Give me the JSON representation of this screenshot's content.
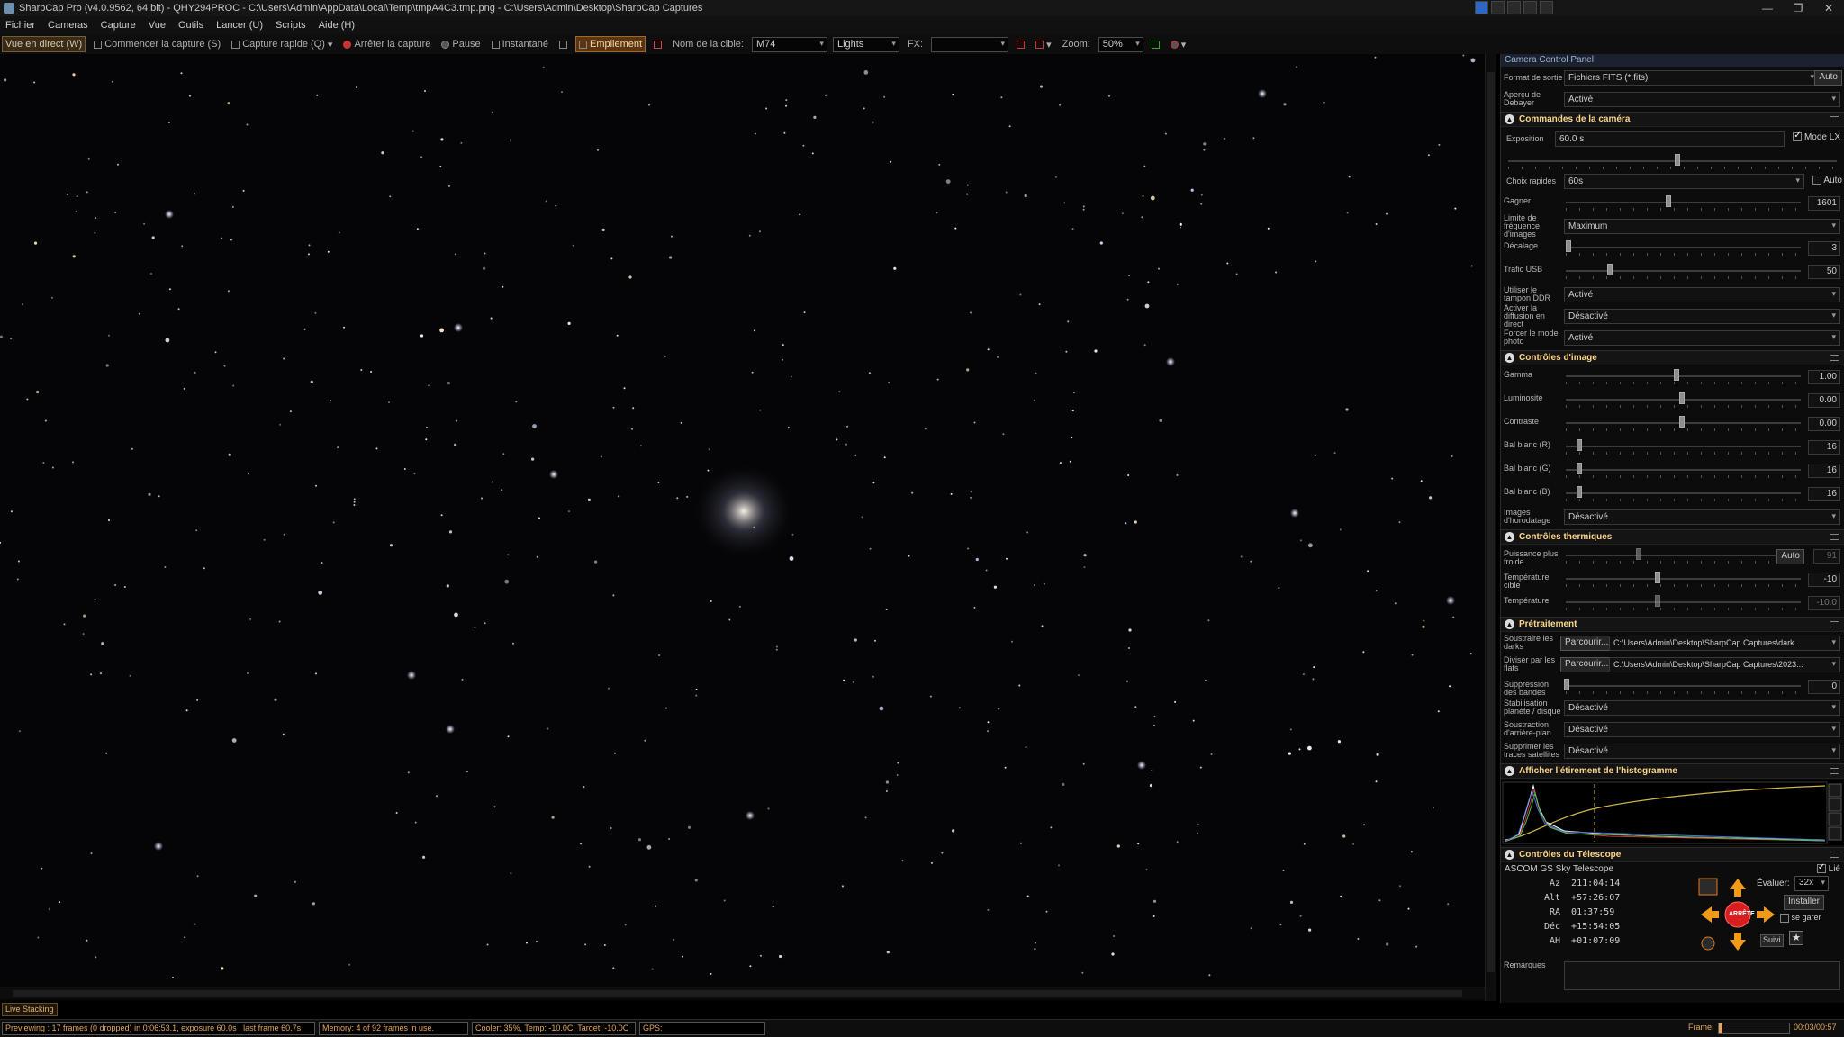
{
  "window": {
    "title": "SharpCap Pro (v4.0.9562, 64 bit) - QHY294PROC - C:\\Users\\Admin\\AppData\\Local\\Temp\\tmpA4C3.tmp.png - C:\\Users\\Admin\\Desktop\\SharpCap Captures",
    "controls": [
      "—",
      "❐",
      "✕"
    ]
  },
  "menu": [
    "Fichier",
    "Cameras",
    "Capture",
    "Vue",
    "Outils",
    "Lancer (U)",
    "Scripts",
    "Aide (H)"
  ],
  "toolbar": {
    "live_view": "Vue en direct (W)",
    "start_capture": "Commencer la capture (S)",
    "quick_capture": "Capture rapide (Q)",
    "stop_capture": "Arrêter la capture",
    "pause": "Pause",
    "snapshot": "Instantané",
    "stacking": "Empilement",
    "target_label": "Nom de la cible:",
    "target_value": "M74",
    "frame_type": "Lights",
    "fx_label": "FX:",
    "fx_value": "",
    "zoom_label": "Zoom:",
    "zoom_value": "50%"
  },
  "panel": {
    "title": "Camera Control Panel",
    "output_format_label": "Format de sortie",
    "output_format_value": "Fichiers FITS (*.fits)",
    "output_format_auto": "Auto",
    "debayer_label": "Aperçu de Debayer",
    "debayer_value": "Activé",
    "camera_section": "Commandes de la caméra",
    "exposure_label": "Exposition",
    "exposure_value": "60.0 s",
    "lx_mode": "Mode LX",
    "quick_choice_label": "Choix rapides",
    "quick_choice_value": "60s",
    "quick_choice_auto": "Auto",
    "gain_label": "Gagner",
    "gain_value": "1601",
    "framerate_label": "Limite de fréquence d'images",
    "framerate_value": "Maximum",
    "offset_label": "Décalage",
    "offset_value": "3",
    "usb_label": "Trafic USB",
    "usb_value": "50",
    "ddr_label": "Utiliser le tampon DDR",
    "ddr_value": "Activé",
    "broadcast_label": "Activer la diffusion en direct",
    "broadcast_value": "Désactivé",
    "photo_label": "Forcer le mode photo",
    "photo_value": "Activé",
    "image_section": "Contrôles d'image",
    "gamma_label": "Gamma",
    "gamma_value": "1.00",
    "brightness_label": "Luminosité",
    "brightness_value": "0.00",
    "contrast_label": "Contraste",
    "contrast_value": "0.00",
    "wbr_label": "Bal blanc (R)",
    "wbr_value": "16",
    "wbg_label": "Bal blanc (G)",
    "wbg_value": "16",
    "wbb_label": "Bal blanc (B)",
    "wbb_value": "16",
    "timestamp_label": "Images d'horodatage",
    "timestamp_value": "Désactivé",
    "thermal_section": "Contrôles thermiques",
    "cooler_label": "Puissance plus froide",
    "cooler_auto": "Auto",
    "cooler_value": "91",
    "target_temp_label": "Température cible",
    "target_temp_value": "-10",
    "temp_label": "Température",
    "temp_value": "-10.0",
    "preproc_section": "Prétraitement",
    "darks_label": "Soustraire les darks",
    "darks_browse": "Parcourir...",
    "darks_path": "C:\\Users\\Admin\\Desktop\\SharpCap Captures\\dark...",
    "flats_label": "Diviser par les flats",
    "flats_browse": "Parcourir...",
    "flats_path": "C:\\Users\\Admin\\Desktop\\SharpCap Captures\\2023...",
    "banding_label": "Suppression des bandes",
    "banding_value": "0",
    "stabilize_label": "Stabilisation planète / disque",
    "stabilize_value": "Désactivé",
    "background_label": "Soustraction d'arrière-plan",
    "background_value": "Désactivé",
    "satellite_label": "Supprimer les traces satellites",
    "satellite_value": "Désactivé",
    "histogram_section": "Afficher l'étirement de l'histogramme",
    "telescope_section": "Contrôles du Télescope",
    "telescope_name": "ASCOM GS Sky Telescope",
    "linked": "Lié",
    "az_key": "Az",
    "az_value": "211:04:14",
    "alt_key": "Alt",
    "alt_value": "+57:26:07",
    "ra_key": "RA",
    "ra_value": "01:37:59",
    "dec_key": "Déc",
    "dec_value": "+15:54:05",
    "ah_key": "AH",
    "ah_value": "+01:07:09",
    "rate_label": "Évaluer:",
    "rate_value": "32x",
    "install": "Installer",
    "park": "se garer",
    "stop": "ARRÊTE",
    "follow": "Suivi",
    "notes_label": "Remarques"
  },
  "status": {
    "live_stacking": "Live Stacking",
    "preview": "Previewing : 17 frames (0 dropped) in 0:06:53.1, exposure 60.0s , last frame 60.7s",
    "memory": "Memory: 4 of 92 frames in use.",
    "cooler": "Cooler: 35%, Temp: -10.0C, Target: -10.0C",
    "gps": "GPS:",
    "frame_label": "Frame:",
    "frame_time": "00:03/00:57",
    "frame_progress": 0.05
  },
  "colors": {
    "accent": "#ffd78a",
    "status_text": "#e4a85a",
    "stack_button": "#5a3510"
  }
}
